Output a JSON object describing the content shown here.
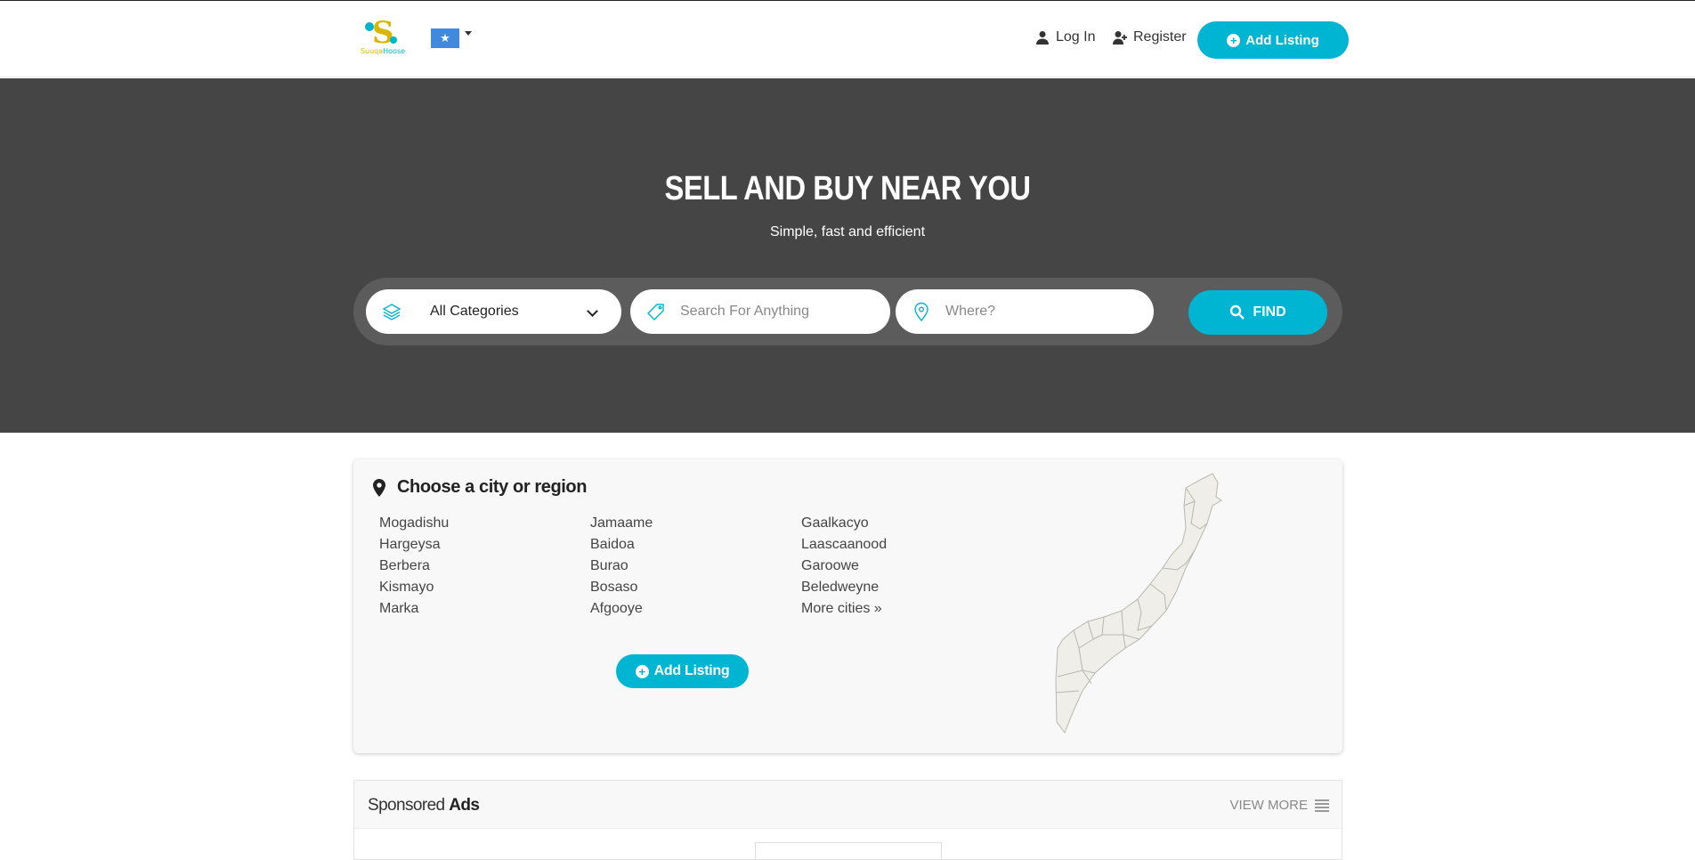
{
  "header": {
    "logo": {
      "text_a": "Suuqa",
      "text_b": "Hoose",
      "alt": "site-logo"
    },
    "flag_icon": "somalia-flag-icon",
    "nav": {
      "login": "Log In",
      "register": "Register"
    },
    "add_listing": "Add Listing"
  },
  "hero": {
    "title": "SELL AND BUY NEAR YOU",
    "subtitle": "Simple, fast and efficient",
    "search": {
      "category_value": "All Categories",
      "keyword_placeholder": "Search For Anything",
      "location_placeholder": "Where?",
      "find_label": "FIND"
    }
  },
  "cities": {
    "title": "Choose a city or region",
    "columns": [
      [
        "Mogadishu",
        "Hargeysa",
        "Berbera",
        "Kismayo",
        "Marka"
      ],
      [
        "Jamaame",
        "Baidoa",
        "Burao",
        "Bosaso",
        "Afgooye"
      ],
      [
        "Gaalkacyo",
        "Laascaanood",
        "Garoowe",
        "Beledweyne",
        "More cities »"
      ]
    ],
    "add_listing": "Add Listing"
  },
  "sponsored": {
    "title_light": "Sponsored",
    "title_bold": "Ads",
    "view_more": "VIEW MORE"
  },
  "colors": {
    "accent": "#00b5d1",
    "hero_bg": "#454545",
    "card_bg": "#f8f8f8"
  }
}
